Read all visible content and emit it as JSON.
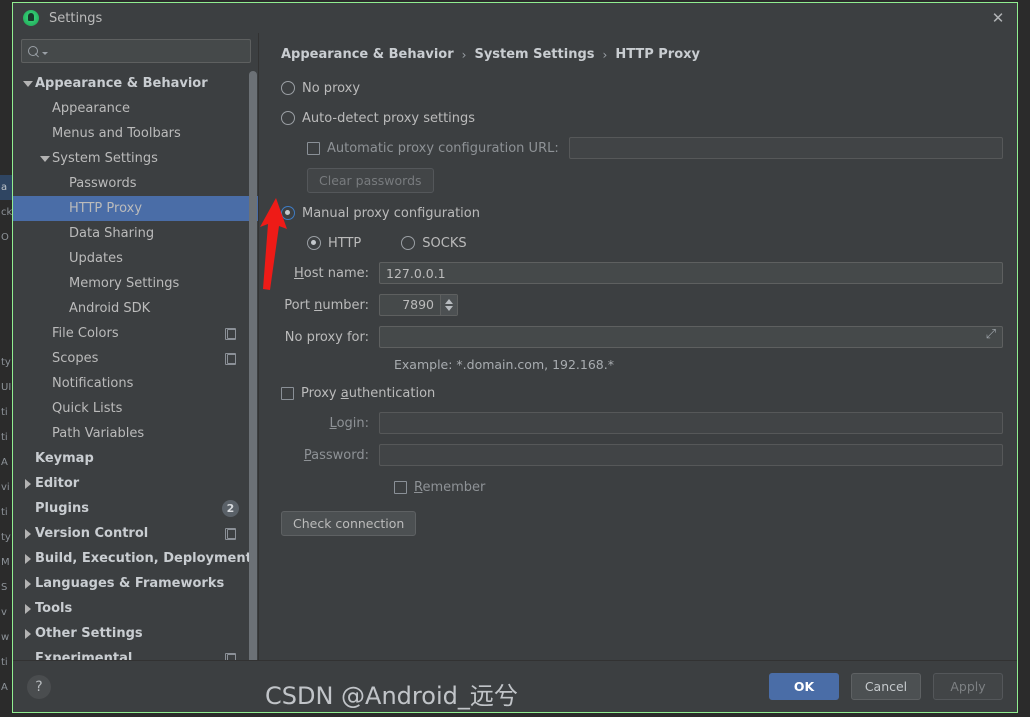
{
  "window": {
    "title": "Settings",
    "logo_icon": "android-studio-logo",
    "close_icon": "close-icon"
  },
  "search": {
    "value": "",
    "placeholder": "",
    "icon": "search-icon",
    "dropdown_icon": "chevron-down-icon"
  },
  "sidebar": {
    "items": [
      {
        "label": "Appearance & Behavior",
        "indent": 0,
        "twisty": "down",
        "bold": true,
        "selected": false,
        "icon": null
      },
      {
        "label": "Appearance",
        "indent": 1,
        "twisty": "none",
        "bold": false,
        "selected": false,
        "icon": null
      },
      {
        "label": "Menus and Toolbars",
        "indent": 1,
        "twisty": "none",
        "bold": false,
        "selected": false,
        "icon": null
      },
      {
        "label": "System Settings",
        "indent": 1,
        "twisty": "down",
        "bold": false,
        "selected": false,
        "icon": null
      },
      {
        "label": "Passwords",
        "indent": 2,
        "twisty": "none",
        "bold": false,
        "selected": false,
        "icon": null
      },
      {
        "label": "HTTP Proxy",
        "indent": 2,
        "twisty": "none",
        "bold": false,
        "selected": true,
        "icon": null
      },
      {
        "label": "Data Sharing",
        "indent": 2,
        "twisty": "none",
        "bold": false,
        "selected": false,
        "icon": null
      },
      {
        "label": "Updates",
        "indent": 2,
        "twisty": "none",
        "bold": false,
        "selected": false,
        "icon": null
      },
      {
        "label": "Memory Settings",
        "indent": 2,
        "twisty": "none",
        "bold": false,
        "selected": false,
        "icon": null
      },
      {
        "label": "Android SDK",
        "indent": 2,
        "twisty": "none",
        "bold": false,
        "selected": false,
        "icon": null
      },
      {
        "label": "File Colors",
        "indent": 1,
        "twisty": "none",
        "bold": false,
        "selected": false,
        "icon": "copy-icon"
      },
      {
        "label": "Scopes",
        "indent": 1,
        "twisty": "none",
        "bold": false,
        "selected": false,
        "icon": "copy-icon"
      },
      {
        "label": "Notifications",
        "indent": 1,
        "twisty": "none",
        "bold": false,
        "selected": false,
        "icon": null
      },
      {
        "label": "Quick Lists",
        "indent": 1,
        "twisty": "none",
        "bold": false,
        "selected": false,
        "icon": null
      },
      {
        "label": "Path Variables",
        "indent": 1,
        "twisty": "none",
        "bold": false,
        "selected": false,
        "icon": null
      },
      {
        "label": "Keymap",
        "indent": 0,
        "twisty": "none",
        "bold": true,
        "selected": false,
        "icon": null
      },
      {
        "label": "Editor",
        "indent": 0,
        "twisty": "right",
        "bold": true,
        "selected": false,
        "icon": null
      },
      {
        "label": "Plugins",
        "indent": 0,
        "twisty": "none",
        "bold": true,
        "selected": false,
        "icon": null,
        "badge": "2"
      },
      {
        "label": "Version Control",
        "indent": 0,
        "twisty": "right",
        "bold": true,
        "selected": false,
        "icon": "copy-icon"
      },
      {
        "label": "Build, Execution, Deployment",
        "indent": 0,
        "twisty": "right",
        "bold": true,
        "selected": false,
        "icon": null
      },
      {
        "label": "Languages & Frameworks",
        "indent": 0,
        "twisty": "right",
        "bold": true,
        "selected": false,
        "icon": null
      },
      {
        "label": "Tools",
        "indent": 0,
        "twisty": "right",
        "bold": true,
        "selected": false,
        "icon": null
      },
      {
        "label": "Other Settings",
        "indent": 0,
        "twisty": "right",
        "bold": true,
        "selected": false,
        "icon": null
      },
      {
        "label": "Experimental",
        "indent": 0,
        "twisty": "none",
        "bold": true,
        "selected": false,
        "icon": "copy-icon"
      }
    ]
  },
  "main": {
    "breadcrumb": [
      "Appearance & Behavior",
      "System Settings",
      "HTTP Proxy"
    ],
    "breadcrumb_separator": "›",
    "no_proxy": {
      "label": "No proxy",
      "checked": false
    },
    "auto_detect": {
      "label": "Auto-detect proxy settings",
      "checked": false
    },
    "auto_url": {
      "label": "Automatic proxy configuration URL:",
      "checked": false,
      "value": ""
    },
    "clear_passwords": {
      "label": "Clear passwords",
      "enabled": false
    },
    "manual": {
      "label": "Manual proxy configuration",
      "checked": true
    },
    "protocol": {
      "http": {
        "label": "HTTP",
        "checked": true
      },
      "socks": {
        "label": "SOCKS",
        "checked": false
      }
    },
    "host": {
      "label": "Host name:",
      "value": "127.0.0.1"
    },
    "port": {
      "label": "Port number:",
      "value": "7890",
      "spinner_icon": "spinner-arrows-icon"
    },
    "no_proxy_for": {
      "label": "No proxy for:",
      "value": "",
      "expand_icon": "expand-icon"
    },
    "example_note": "Example: *.domain.com, 192.168.*",
    "proxy_auth": {
      "label": "Proxy authentication",
      "checked": false
    },
    "login": {
      "label": "Login:",
      "value": ""
    },
    "password": {
      "label": "Password:",
      "value": ""
    },
    "remember": {
      "label": "Remember",
      "checked": false
    },
    "check_connection": {
      "label": "Check connection"
    }
  },
  "footer": {
    "help_label": "?",
    "ok": "OK",
    "cancel": "Cancel",
    "apply": "Apply"
  },
  "annotations": {
    "watermark": "CSDN @Android_远兮",
    "arrow_color": "#ee1b17"
  },
  "background_strip_left": [
    "",
    "",
    "",
    "",
    "",
    "",
    "",
    "a",
    "ck",
    "O",
    "",
    "",
    "",
    "",
    "ty",
    "UI",
    "ti",
    "ti",
    "A",
    "vi",
    "ti",
    "ty",
    "M",
    "S",
    "v",
    "w",
    "ti",
    "A"
  ],
  "colors": {
    "selection": "#4a6da7",
    "panel": "#3c3f41",
    "field": "#45494a",
    "text": "#bbbbbb",
    "border": "#90ee90"
  }
}
